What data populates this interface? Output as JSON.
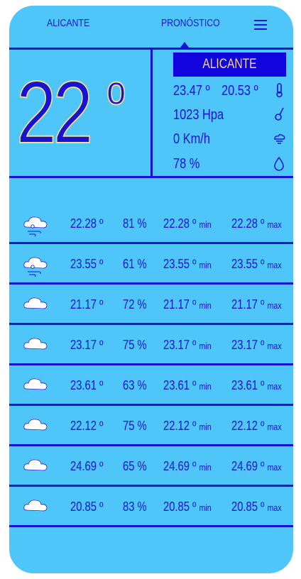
{
  "nav": {
    "city": "ALICANTE",
    "forecast": "PRONÓSTICO"
  },
  "current": {
    "temp": "22",
    "deg": "º",
    "city": "ALICANTE",
    "temp_max": "23.47 º",
    "temp_min": "20.53 º",
    "pressure": "1023 Hpa",
    "wind": "0 Km/h",
    "humidity": "78 %"
  },
  "forecast": [
    {
      "icon": "cloud-wind-icon",
      "temp": "22.28 º",
      "humidity": "81 %",
      "min": "22.28 º",
      "max": "22.28 º"
    },
    {
      "icon": "cloud-wind-icon",
      "temp": "23.55 º",
      "humidity": "61 %",
      "min": "23.55 º",
      "max": "23.55 º"
    },
    {
      "icon": "cloud-icon",
      "temp": "21.17 º",
      "humidity": "72 %",
      "min": "21.17 º",
      "max": "21.17 º"
    },
    {
      "icon": "cloud-icon",
      "temp": "23.17 º",
      "humidity": "75 %",
      "min": "23.17 º",
      "max": "23.17 º"
    },
    {
      "icon": "cloud-icon",
      "temp": "23.61 º",
      "humidity": "63 %",
      "min": "23.61 º",
      "max": "23.61 º"
    },
    {
      "icon": "cloud-icon",
      "temp": "22.12 º",
      "humidity": "75 %",
      "min": "22.12 º",
      "max": "22.12 º"
    },
    {
      "icon": "cloud-icon",
      "temp": "24.69 º",
      "humidity": "65 %",
      "min": "24.69 º",
      "max": "24.69 º"
    },
    {
      "icon": "cloud-icon",
      "temp": "20.85 º",
      "humidity": "83 %",
      "min": "20.85 º",
      "max": "20.85 º"
    }
  ],
  "labels": {
    "min": "min",
    "max": "max"
  },
  "colors": {
    "background": "#4ec6f9",
    "accent": "#1713d4",
    "highlight": "#f2d98c"
  }
}
